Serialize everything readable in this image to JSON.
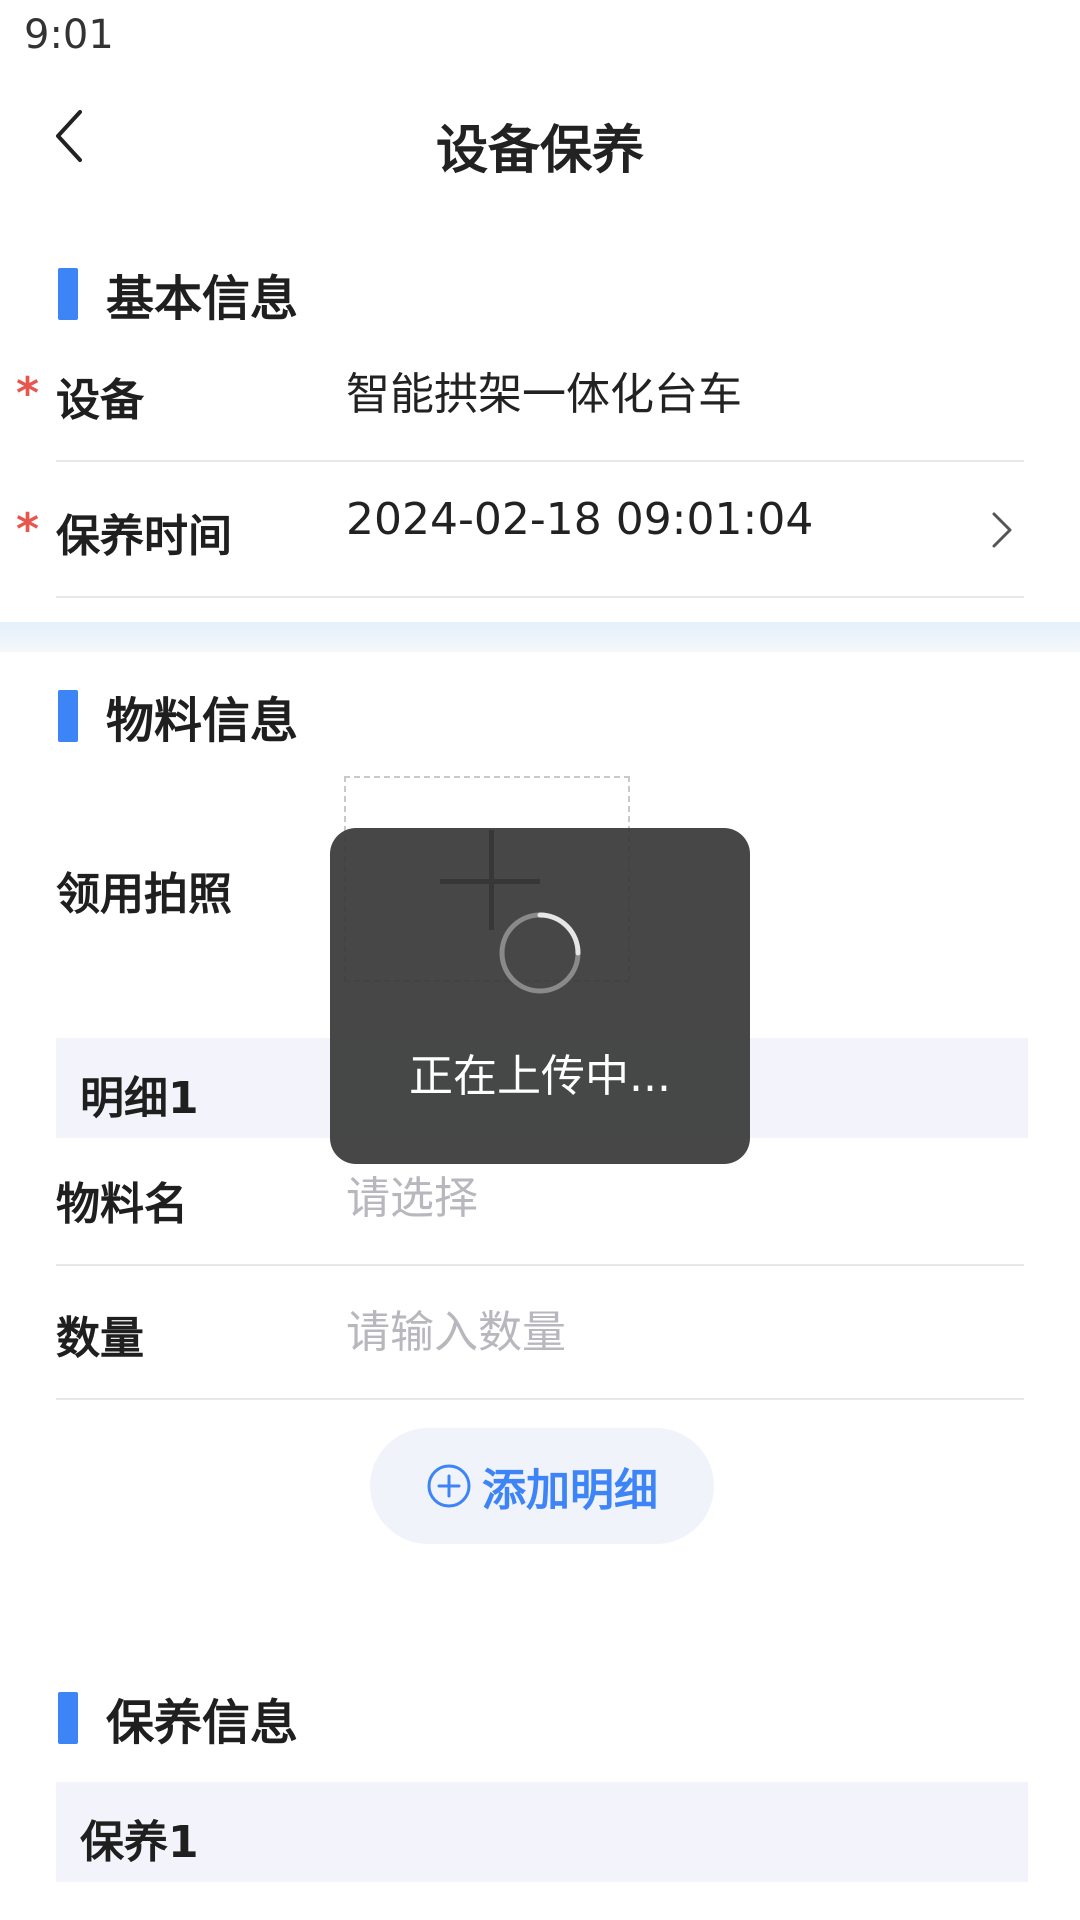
{
  "status_bar": {
    "time": "9:01"
  },
  "nav": {
    "title": "设备保养",
    "back_icon": "chevron-left-icon"
  },
  "basic_info": {
    "section_title": "基本信息",
    "fields": [
      {
        "label": "设备",
        "value": "智能拱架一体化台车",
        "required": true
      },
      {
        "label": "保养时间",
        "value": "2024-02-18 09:01:04",
        "required": true
      }
    ]
  },
  "material_info": {
    "section_title": "物料信息",
    "photo_label": "领用拍照",
    "detail": {
      "title": "明细1",
      "fields": [
        {
          "label": "物料名",
          "placeholder": "请选择"
        },
        {
          "label": "数量",
          "placeholder": "请输入数量"
        }
      ]
    },
    "add_button_label": "添加明细"
  },
  "maintenance_info": {
    "section_title": "保养信息",
    "group_title": "保养1"
  },
  "toast": {
    "text": "正在上传中..."
  },
  "colors": {
    "accent": "#3d84f6",
    "required": "#e8564e",
    "placeholder": "#b7b7bd"
  }
}
